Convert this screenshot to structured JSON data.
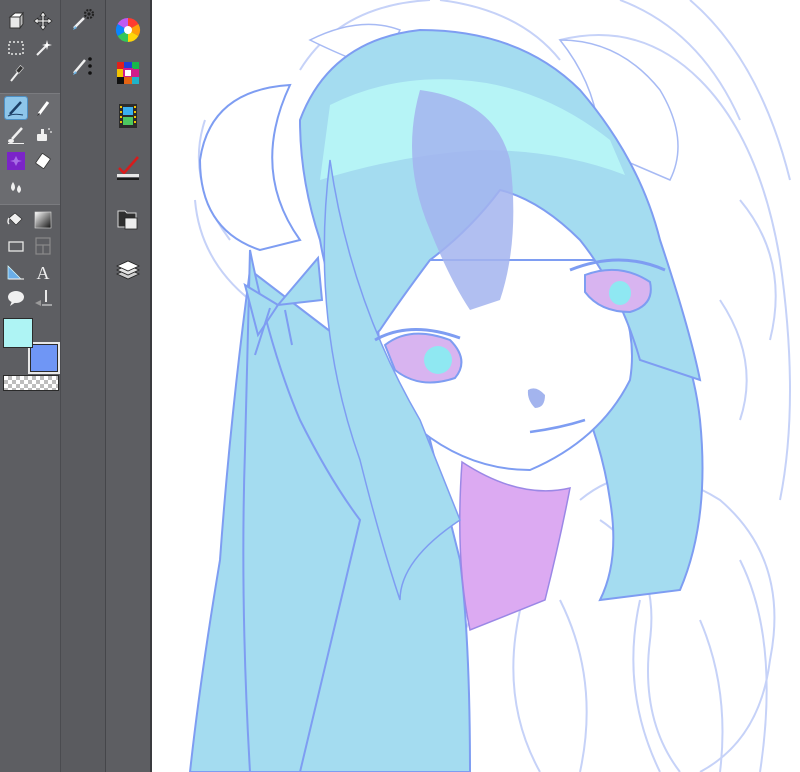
{
  "colors": {
    "main_color": "#aef4f4",
    "sub_color": "#6f96f5",
    "panel_bg": "#5d5e62",
    "active_tool": "#8ec6ea",
    "hair_light": "#a4dcf0",
    "hair_highlight": "#b6f4f6",
    "hair_shadow": "#a3b4ee",
    "line": "#7e9df2",
    "tongue": "#dcaaf2",
    "sketch": "#c6d2f8"
  },
  "tools": [
    {
      "icon": "zoom-icon"
    },
    {
      "icon": "move-icon"
    },
    {
      "icon": "selection-icon"
    },
    {
      "icon": "auto-select-icon"
    },
    {
      "icon": "eyedropper-icon"
    },
    {
      "icon": "pen-icon"
    },
    {
      "icon": "pencil-icon"
    },
    {
      "icon": "brush-icon"
    },
    {
      "icon": "airbrush-icon"
    },
    {
      "icon": "decoration-icon"
    },
    {
      "icon": "eraser-icon"
    },
    {
      "icon": "blend-icon"
    },
    {
      "icon": "fill-icon"
    },
    {
      "icon": "gradient-icon"
    },
    {
      "icon": "figure-icon"
    },
    {
      "icon": "frame-border-icon"
    },
    {
      "icon": "ruler-icon"
    },
    {
      "icon": "text-icon"
    },
    {
      "icon": "balloon-icon"
    },
    {
      "icon": "correct-line-icon"
    }
  ],
  "sub_tools": [
    {
      "icon": "object-tool-icon"
    },
    {
      "icon": "pen-settings-icon"
    }
  ],
  "command_bar": [
    {
      "icon": "color-wheel-icon"
    },
    {
      "icon": "color-set-icon"
    },
    {
      "icon": "animation-icon"
    },
    {
      "icon": "stabilizer-icon"
    },
    {
      "icon": "material-icon"
    },
    {
      "icon": "layer-icon"
    }
  ]
}
